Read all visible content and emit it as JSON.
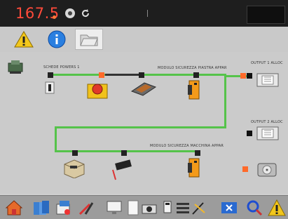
{
  "statusbar": {
    "readout": "167.5"
  },
  "toolbar": {
    "buttons": [
      "warning",
      "info",
      "folder"
    ]
  },
  "diagram": {
    "labels": {
      "top_left": "SCHEDE POWERS 1",
      "top_right": "MODULO SICUREZZA PIASTRA APPAR",
      "right_top": "OUTPUT 1 ALLOC",
      "right_mid": "OUTPUT 2 ALLOC",
      "mid_right": "MODULO SICUREZZA MACCHINA APPAR"
    }
  },
  "bottombar": {
    "icons": [
      "home",
      "files",
      "network",
      "tools",
      "display",
      "blank",
      "camera",
      "usb",
      "menu",
      "cut",
      "bluetooth",
      "search",
      "warning"
    ]
  },
  "colors": {
    "connector": "#55c34a",
    "readout": "#ff4a3a"
  }
}
